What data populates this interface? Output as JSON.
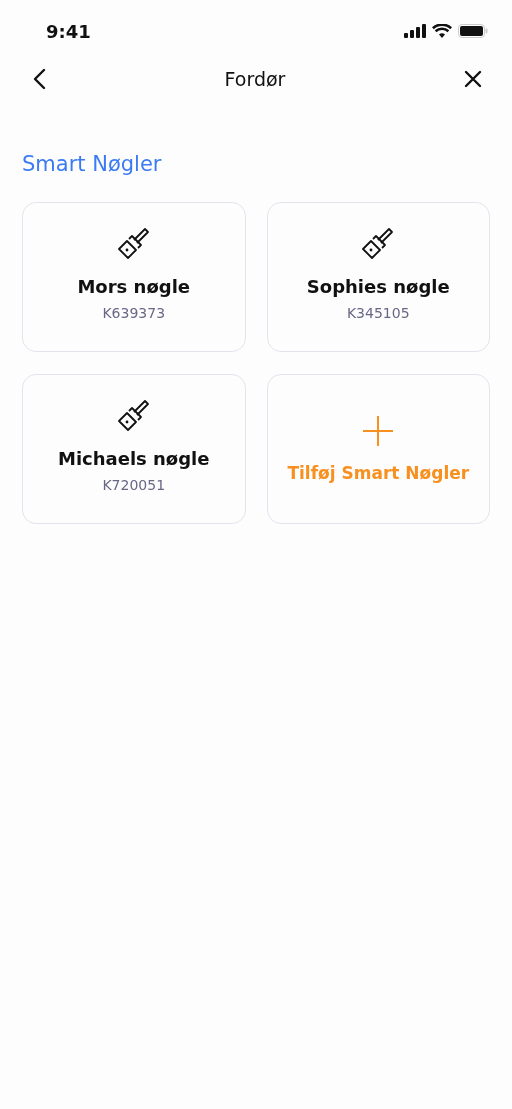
{
  "status_bar": {
    "time": "9:41"
  },
  "header": {
    "title": "Fordør"
  },
  "section": {
    "title": "Smart Nøgler"
  },
  "cards": [
    {
      "kind": "key",
      "name": "Mors nøgle",
      "code": "K639373"
    },
    {
      "kind": "key",
      "name": "Sophies nøgle",
      "code": "K345105"
    },
    {
      "kind": "key",
      "name": "Michaels nøgle",
      "code": "K720051"
    },
    {
      "kind": "add",
      "label": "Tilføj Smart Nøgler"
    }
  ]
}
